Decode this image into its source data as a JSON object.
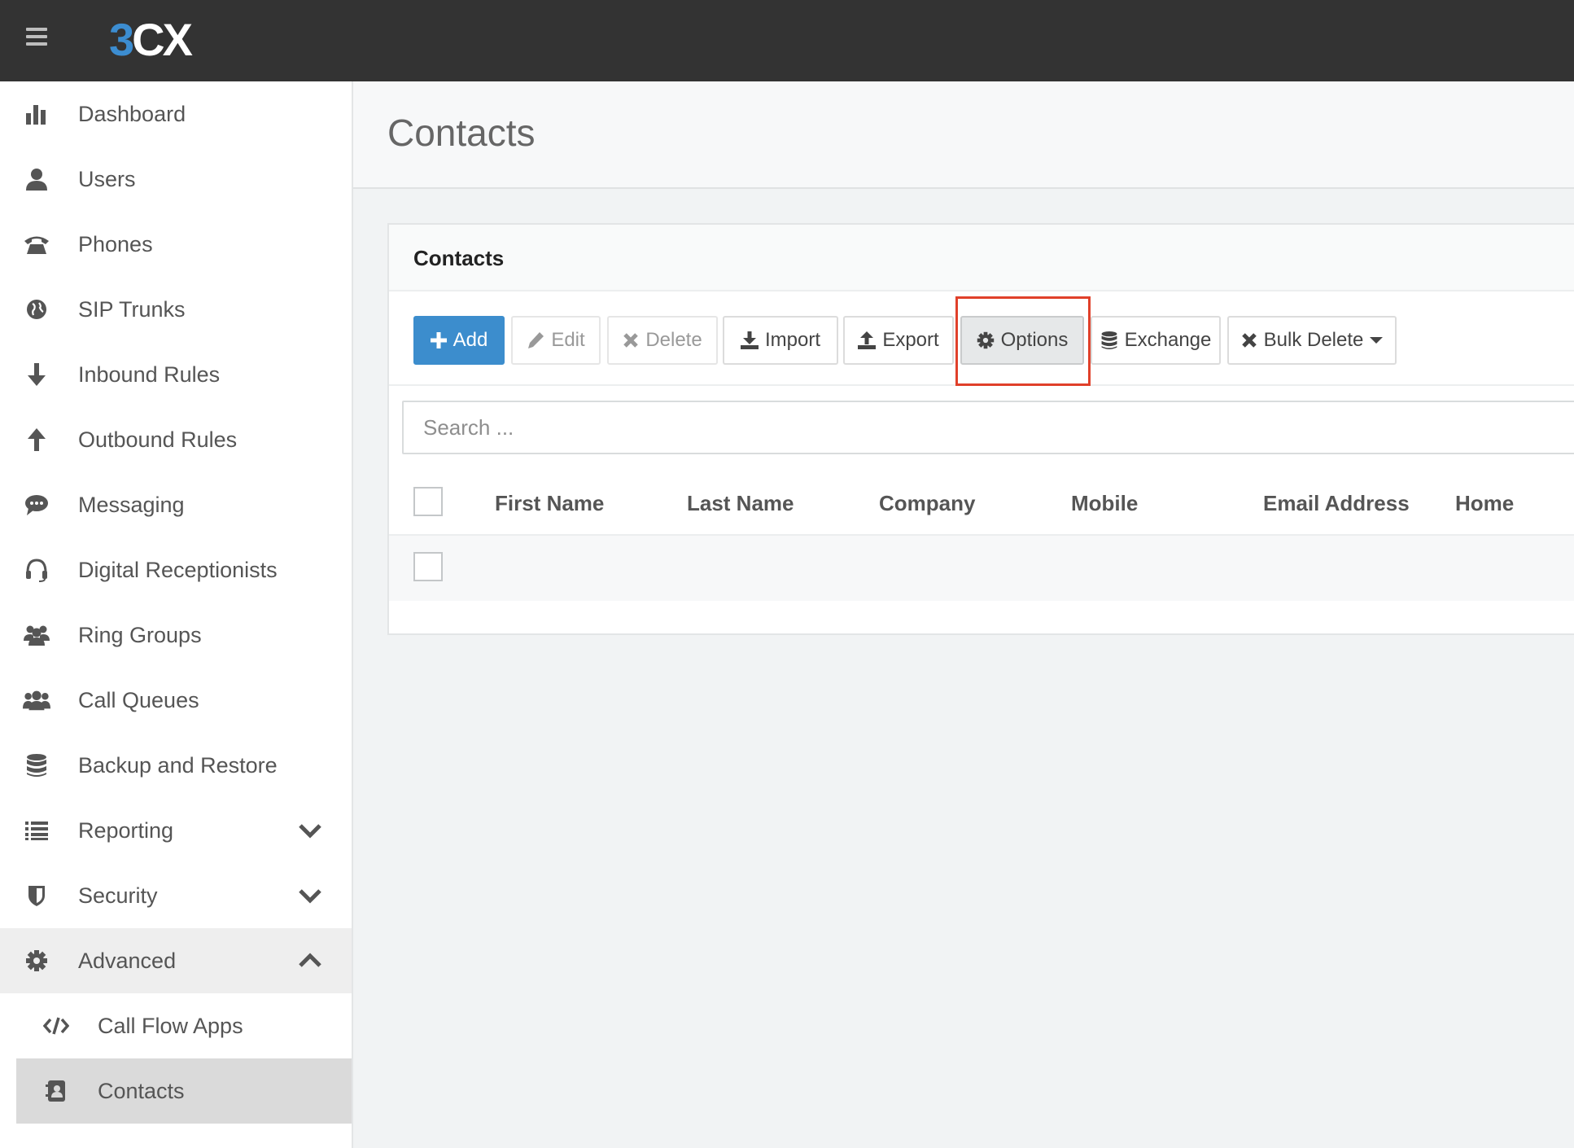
{
  "app": {
    "logo_left": "3",
    "logo_right": "CX"
  },
  "sidebar": {
    "items": [
      {
        "label": "Dashboard",
        "icon": "bar-chart-icon"
      },
      {
        "label": "Users",
        "icon": "user-icon"
      },
      {
        "label": "Phones",
        "icon": "phone-icon"
      },
      {
        "label": "SIP Trunks",
        "icon": "globe-icon"
      },
      {
        "label": "Inbound Rules",
        "icon": "arrow-down-icon"
      },
      {
        "label": "Outbound Rules",
        "icon": "arrow-up-icon"
      },
      {
        "label": "Messaging",
        "icon": "chat-bubble-icon"
      },
      {
        "label": "Digital Receptionists",
        "icon": "headset-icon"
      },
      {
        "label": "Ring Groups",
        "icon": "group-icon"
      },
      {
        "label": "Call Queues",
        "icon": "users-icon"
      },
      {
        "label": "Backup and Restore",
        "icon": "database-icon"
      },
      {
        "label": "Reporting",
        "icon": "list-icon"
      },
      {
        "label": "Security",
        "icon": "shield-icon"
      },
      {
        "label": "Advanced",
        "icon": "gear-icon"
      },
      {
        "label": "Call Flow Apps",
        "icon": "code-icon"
      },
      {
        "label": "Contacts",
        "icon": "address-book-icon"
      }
    ]
  },
  "page": {
    "title": "Contacts"
  },
  "panel": {
    "title": "Contacts",
    "toolbar": {
      "add": "Add",
      "edit": "Edit",
      "delete": "Delete",
      "import": "Import",
      "export": "Export",
      "options": "Options",
      "exchange": "Exchange",
      "bulk_delete": "Bulk Delete"
    },
    "search_placeholder": "Search ...",
    "columns": [
      "First Name",
      "Last Name",
      "Company",
      "Mobile",
      "Email Address",
      "Home"
    ]
  },
  "colors": {
    "topbar": "#333333",
    "brand": "#3c8dcd",
    "highlight": "#e0402a"
  }
}
